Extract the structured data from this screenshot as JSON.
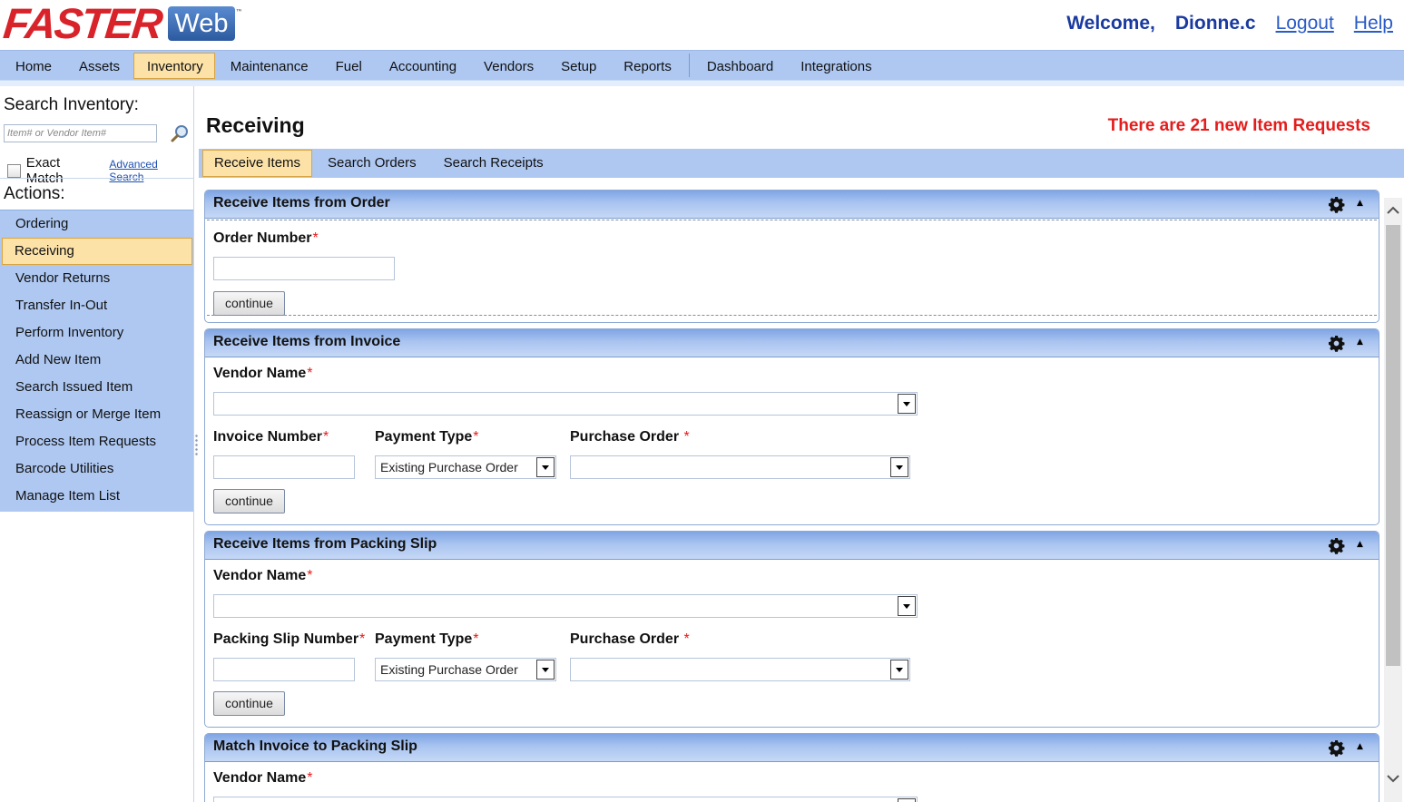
{
  "app": {
    "logo_primary": "FASTER",
    "logo_secondary": "Web",
    "logo_tm": "™",
    "welcome": "Welcome,",
    "username": "Dionne.c",
    "logout": "Logout",
    "help": "Help"
  },
  "nav": {
    "items": [
      "Home",
      "Assets",
      "Inventory",
      "Maintenance",
      "Fuel",
      "Accounting",
      "Vendors",
      "Setup",
      "Reports",
      "Dashboard",
      "Integrations"
    ],
    "active": "Inventory"
  },
  "sidebar": {
    "search_title": "Search Inventory:",
    "search_placeholder": "Item# or Vendor Item#",
    "exact_match": "Exact Match",
    "advanced_search": "Advanced Search",
    "actions_title": "Actions:",
    "actions": [
      "Ordering",
      "Receiving",
      "Vendor Returns",
      "Transfer In-Out",
      "Perform Inventory",
      "Add New Item",
      "Search Issued Item",
      "Reassign or Merge Item",
      "Process Item Requests",
      "Barcode Utilities",
      "Manage Item List"
    ],
    "active_action": "Receiving"
  },
  "content": {
    "title": "Receiving",
    "alert": "There are 21 new Item Requests",
    "tabs": [
      "Receive Items",
      "Search Orders",
      "Search Receipts"
    ],
    "active_tab": "Receive Items"
  },
  "panels": {
    "order": {
      "title": "Receive Items from Order",
      "order_number_label": "Order Number",
      "continue": "continue"
    },
    "invoice": {
      "title": "Receive Items from Invoice",
      "vendor_name_label": "Vendor Name",
      "invoice_number_label": "Invoice Number",
      "payment_type_label": "Payment Type",
      "payment_type_value": "Existing Purchase Order",
      "purchase_order_label": "Purchase Order",
      "continue": "continue"
    },
    "packing": {
      "title": "Receive Items from Packing Slip",
      "vendor_name_label": "Vendor Name",
      "packing_slip_label": "Packing Slip Number",
      "payment_type_label": "Payment Type",
      "payment_type_value": "Existing Purchase Order",
      "purchase_order_label": "Purchase Order",
      "continue": "continue"
    },
    "match": {
      "title": "Match Invoice to Packing Slip",
      "vendor_name_label": "Vendor Name"
    },
    "required_marker": "*"
  },
  "colors": {
    "nav_bg": "#aec8f2",
    "active_bg": "#fde2a8",
    "alert": "#e41c1c",
    "brand_red": "#d8232a",
    "brand_blue": "#1a3aa0"
  }
}
